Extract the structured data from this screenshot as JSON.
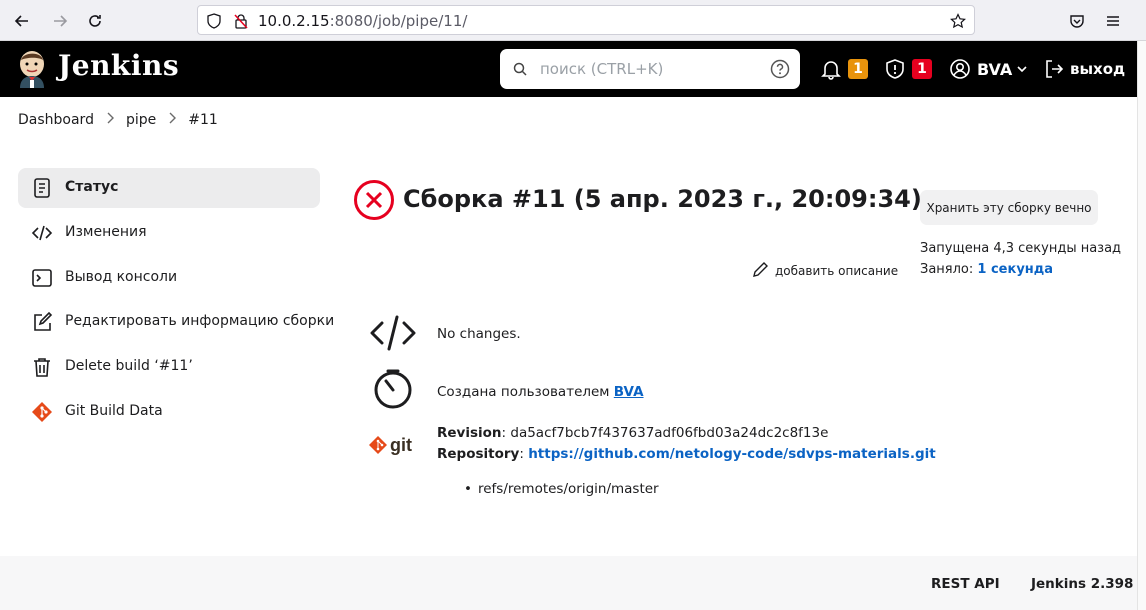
{
  "browser": {
    "url_host": "10.0.2.15",
    "url_rest": ":8080/job/pipe/11/"
  },
  "header": {
    "brand": "Jenkins",
    "search_placeholder": "поиск (CTRL+K)",
    "notifications_count": "1",
    "security_count": "1",
    "user": "BVA",
    "logout": "выход"
  },
  "breadcrumb": [
    "Dashboard",
    "pipe",
    "#11"
  ],
  "sidebar": {
    "items": [
      {
        "label": "Статус"
      },
      {
        "label": "Изменения"
      },
      {
        "label": "Вывод консоли"
      },
      {
        "label": "Редактировать информацию сборки"
      },
      {
        "label": "Delete build ‘#11’"
      },
      {
        "label": "Git Build Data"
      }
    ]
  },
  "main": {
    "title": "Сборка #11 (5 апр. 2023 г., 20:09:34)",
    "keep_button": "Хранить эту сборку вечно",
    "started": "Запущена 4,3 секунды назад",
    "took_label": "Заняло:",
    "took_value": "1 секунда",
    "add_description": "добавить описание",
    "changes": "No changes.",
    "created_by_label": "Создана пользователем",
    "created_by_user": "BVA",
    "revision_label": "Revision",
    "revision_value": "da5acf7bcb7f437637adf06fbd03a24dc2c8f13e",
    "repository_label": "Repository",
    "repository_value": "https://github.com/netology-code/sdvps-materials.git",
    "branch": "refs/remotes/origin/master"
  },
  "footer": {
    "rest_api": "REST API",
    "version": "Jenkins 2.398"
  },
  "colors": {
    "header_bg": "#000000",
    "notification_badge": "#e8930c",
    "security_badge": "#e6001f",
    "failure_red": "#e6001f",
    "link": "#0b63c4"
  }
}
